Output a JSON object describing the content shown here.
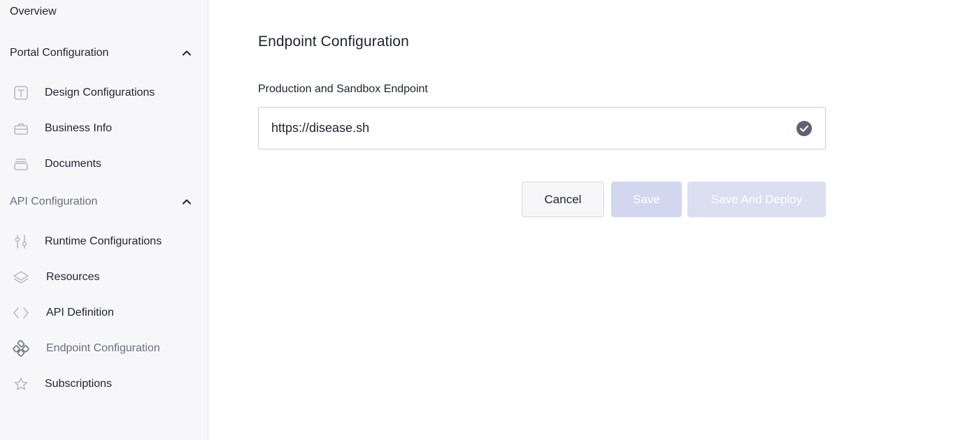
{
  "sidebar": {
    "overview": "Overview",
    "portal_section": {
      "label": "Portal Configuration",
      "items": [
        {
          "label": "Design Configurations",
          "icon": "text-box-icon"
        },
        {
          "label": "Business Info",
          "icon": "briefcase-icon"
        },
        {
          "label": "Documents",
          "icon": "documents-icon"
        }
      ]
    },
    "api_section": {
      "label": "API Configuration",
      "items": [
        {
          "label": "Runtime Configurations",
          "icon": "sliders-icon"
        },
        {
          "label": "Resources",
          "icon": "layers-icon"
        },
        {
          "label": "API Definition",
          "icon": "code-icon"
        },
        {
          "label": "Endpoint Configuration",
          "icon": "endpoint-icon",
          "active": true
        },
        {
          "label": "Subscriptions",
          "icon": "star-icon"
        }
      ]
    }
  },
  "main": {
    "title": "Endpoint Configuration",
    "field_label": "Production and Sandbox Endpoint",
    "endpoint_value": "https://disease.sh",
    "buttons": {
      "cancel": "Cancel",
      "save": "Save",
      "save_deploy": "Save And Deploy"
    }
  },
  "colors": {
    "sidebar_bg": "#f7f7f9",
    "primary_disabled": "#d3d6ef",
    "text": "#1f2230",
    "muted_icon": "#b7b9c4"
  }
}
